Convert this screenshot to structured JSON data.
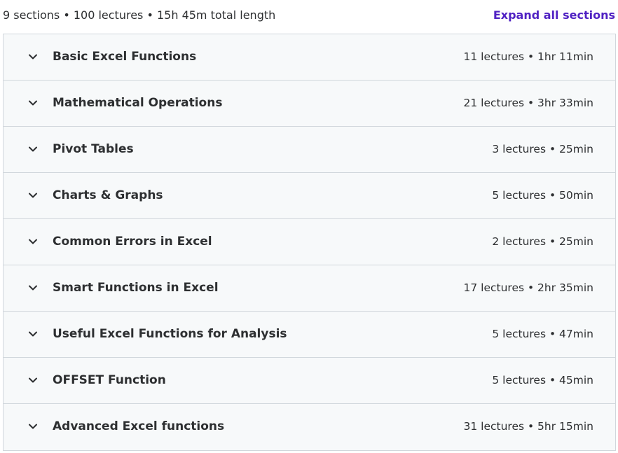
{
  "summary": {
    "text": "9 sections • 100 lectures • 15h 45m total length",
    "expand_label": "Expand all sections"
  },
  "colors": {
    "accent": "#5022c3",
    "row_bg": "#f7f9fa",
    "border": "#d1d7dc"
  },
  "sections": [
    {
      "title": "Basic Excel Functions",
      "meta": "11 lectures • 1hr 11min",
      "icon": "chevron-down-icon"
    },
    {
      "title": "Mathematical Operations",
      "meta": "21 lectures • 3hr 33min",
      "icon": "chevron-down-icon"
    },
    {
      "title": "Pivot Tables",
      "meta": "3 lectures • 25min",
      "icon": "chevron-down-icon"
    },
    {
      "title": "Charts & Graphs",
      "meta": "5 lectures • 50min",
      "icon": "chevron-down-icon"
    },
    {
      "title": "Common Errors in Excel",
      "meta": "2 lectures • 25min",
      "icon": "chevron-down-icon"
    },
    {
      "title": "Smart Functions in Excel",
      "meta": "17 lectures • 2hr 35min",
      "icon": "chevron-down-icon"
    },
    {
      "title": "Useful Excel Functions for Analysis",
      "meta": "5 lectures • 47min",
      "icon": "chevron-down-icon"
    },
    {
      "title": "OFFSET Function",
      "meta": "5 lectures • 45min",
      "icon": "chevron-down-icon"
    },
    {
      "title": "Advanced Excel functions",
      "meta": "31 lectures • 5hr 15min",
      "icon": "chevron-down-icon"
    }
  ]
}
